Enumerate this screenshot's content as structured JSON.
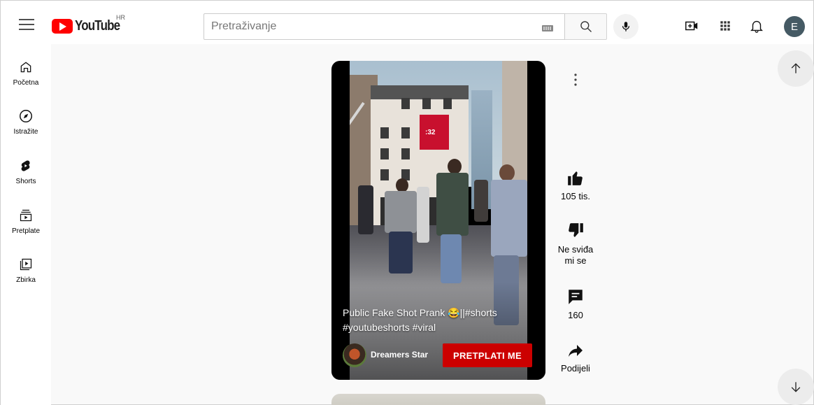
{
  "header": {
    "logo_text": "YouTube",
    "country_code": "HR",
    "search_placeholder": "Pretraživanje",
    "avatar_letter": "E",
    "icons": [
      "menu-icon",
      "keyboard-icon",
      "search-icon",
      "microphone-icon",
      "create-video-icon",
      "apps-grid-icon",
      "notifications-bell-icon"
    ]
  },
  "sidebar": {
    "items": [
      {
        "label": "Početna",
        "icon": "home-icon"
      },
      {
        "label": "Istražite",
        "icon": "explore-compass-icon"
      },
      {
        "label": "Shorts",
        "icon": "shorts-icon"
      },
      {
        "label": "Pretplate",
        "icon": "subscriptions-icon"
      },
      {
        "label": "Zbirka",
        "icon": "library-icon"
      }
    ]
  },
  "short": {
    "title": "Public Fake Shot Prank 😂||#shorts #youtubeshorts #viral",
    "channel_name": "Dreamers Star",
    "subscribe_label": "PRETPLATI ME",
    "billboard_text": ":32"
  },
  "actions": {
    "like_count": "105 tis.",
    "dislike_label": "Ne sviđa mi se",
    "comment_count": "160",
    "share_label": "Podijeli"
  },
  "navigation": {
    "up_icon": "arrow-up-icon",
    "down_icon": "arrow-down-icon"
  },
  "colors": {
    "brand_red": "#ff0000",
    "subscribe_red": "#cc0000",
    "avatar_bg": "#455a64"
  }
}
